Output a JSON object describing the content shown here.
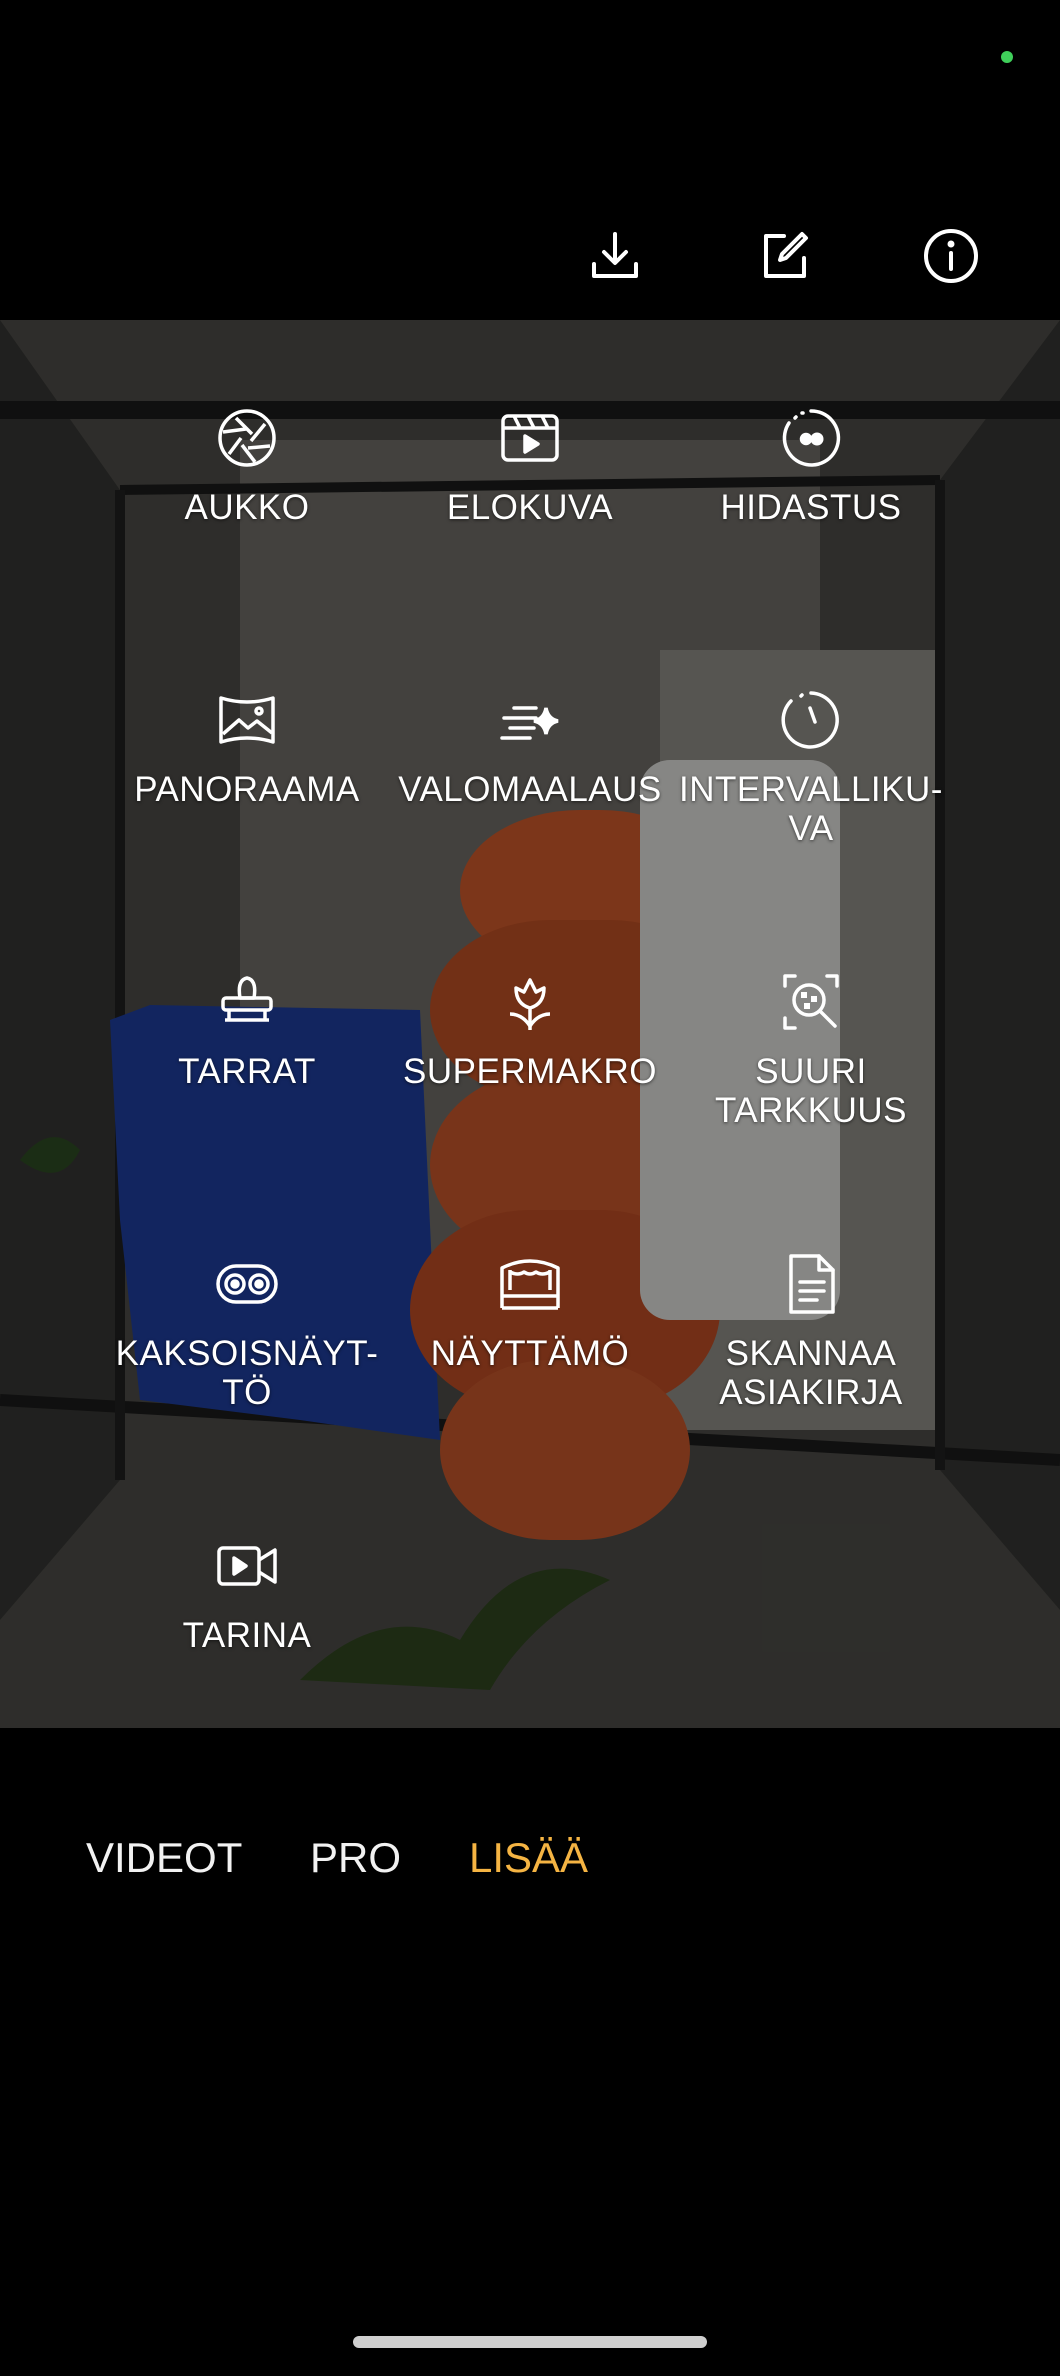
{
  "colors": {
    "accent": "#f5b443",
    "status_dot": "#3fcf5a",
    "background": "#000000"
  },
  "toolbar": {
    "download_icon": "download-icon",
    "edit_icon": "edit-icon",
    "info_icon": "info-icon"
  },
  "modes": [
    {
      "label": "AUKKO",
      "icon": "aperture-icon"
    },
    {
      "label": "ELOKUVA",
      "icon": "cinema-icon"
    },
    {
      "label": "HIDASTUS",
      "icon": "slow-motion-icon"
    },
    {
      "label": "PANORAAMA",
      "icon": "panorama-icon"
    },
    {
      "label": "VALOMAALAUS",
      "icon": "light-painting-icon"
    },
    {
      "label": "INTERVALLIKU-\nVA",
      "icon": "timelapse-icon"
    },
    {
      "label": "TARRAT",
      "icon": "stamp-icon"
    },
    {
      "label": "SUPERMAKRO",
      "icon": "flower-macro-icon"
    },
    {
      "label": "SUURI\nTARKKUUS",
      "icon": "high-resolution-icon"
    },
    {
      "label": "KAKSOISNÄYT-\nTÖ",
      "icon": "dual-view-icon"
    },
    {
      "label": "NÄYTTÄMÖ",
      "icon": "stage-icon"
    },
    {
      "label": "SKANNAA\nASIAKIRJA",
      "icon": "document-scan-icon"
    },
    {
      "label": "TARINA",
      "icon": "story-video-icon"
    }
  ],
  "tabs": {
    "videot": "VIDEOT",
    "pro": "PRO",
    "lisaa": "LISÄÄ"
  }
}
